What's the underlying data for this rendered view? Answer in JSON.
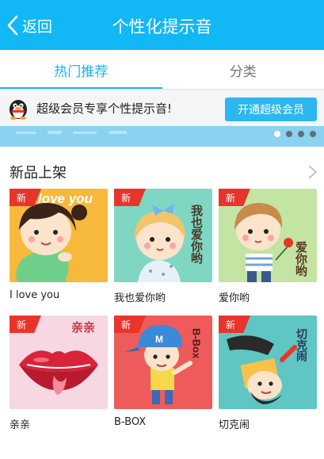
{
  "header": {
    "back_label": "返回",
    "title": "个性化提示音"
  },
  "tabs": [
    {
      "label": "热门推荐",
      "active": true
    },
    {
      "label": "分类",
      "active": false
    }
  ],
  "banner": {
    "text": "超级会员专享个性提示音!",
    "button_label": "开通超级会员",
    "page_count": 4,
    "active_page": 1
  },
  "section": {
    "title": "新品上架"
  },
  "items": [
    {
      "title": "I love you",
      "badge": "新",
      "art_text": "love you",
      "bg": "#f7b93c"
    },
    {
      "title": "我也爱你哟",
      "badge": "新",
      "art_text": "我也爱你哟",
      "bg": "#7fd7c3"
    },
    {
      "title": "爱你哟",
      "badge": "新",
      "art_text": "爱你哟",
      "bg": "#c4e4a3"
    },
    {
      "title": "亲亲",
      "badge": "新",
      "art_text": "亲亲",
      "bg": "#f7d7e2"
    },
    {
      "title": "B-BOX",
      "badge": "新",
      "art_text": "B-Box",
      "bg": "#ef5a5a"
    },
    {
      "title": "切克闹",
      "badge": "新",
      "art_text": "切克闹",
      "bg": "#5fc6c3"
    }
  ],
  "colors": {
    "accent": "#12b7f5",
    "badge": "#e8352c"
  }
}
